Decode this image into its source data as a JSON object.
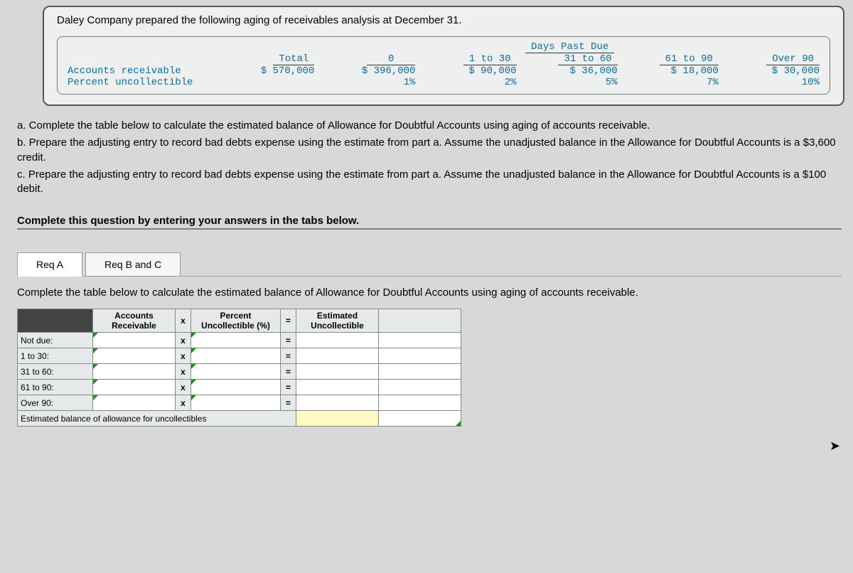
{
  "intro": "Daley Company prepared the following aging of receivables analysis at December 31.",
  "aging": {
    "days_past_due_header": "Days Past Due",
    "cols": [
      "Total",
      "0",
      "1 to 30",
      "31 to 60",
      "61 to 90",
      "Over 90"
    ],
    "rows": {
      "ar_label": "Accounts receivable",
      "ar_vals": [
        "$ 570,000",
        "$ 396,000",
        "$ 90,000",
        "$ 36,000",
        "$ 18,000",
        "$ 30,000"
      ],
      "pu_label": "Percent uncollectible",
      "pu_vals": [
        "",
        "1%",
        "2%",
        "5%",
        "7%",
        "10%"
      ]
    }
  },
  "instructions": {
    "a": "a. Complete the table below to calculate the estimated balance of Allowance for Doubtful Accounts using aging of accounts receivable.",
    "b": "b. Prepare the adjusting entry to record bad debts expense using the estimate from part a. Assume the unadjusted balance in the Allowance for Doubtful Accounts is a $3,600 credit.",
    "c": "c. Prepare the adjusting entry to record bad debts expense using the estimate from part a. Assume the unadjusted balance in the Allowance for Doubtful Accounts is a $100 debit."
  },
  "tabs_prompt": "Complete this question by entering your answers in the tabs below.",
  "tabs": {
    "a": "Req A",
    "bc": "Req B and C"
  },
  "req_a_text": "Complete the table below to calculate the estimated balance of Allowance for Doubtful Accounts using aging of accounts receivable.",
  "worksheet": {
    "headers": {
      "ar": "Accounts Receivable",
      "times": "x",
      "percent": "Percent Uncollectible (%)",
      "equals": "=",
      "est": "Estimated Uncollectible"
    },
    "rows": [
      {
        "label": "Not due:"
      },
      {
        "label": "1 to 30:"
      },
      {
        "label": "31 to 60:"
      },
      {
        "label": "61 to 90:"
      },
      {
        "label": "Over 90:"
      }
    ],
    "total_row": "Estimated balance of allowance for uncollectibles"
  },
  "chart_data": {
    "type": "table",
    "title": "Aging of Receivables Analysis at December 31",
    "categories": [
      "Total",
      "0",
      "1 to 30",
      "31 to 60",
      "61 to 90",
      "Over 90"
    ],
    "series": [
      {
        "name": "Accounts receivable ($)",
        "values": [
          570000,
          396000,
          90000,
          36000,
          18000,
          30000
        ]
      },
      {
        "name": "Percent uncollectible (%)",
        "values": [
          null,
          1,
          2,
          5,
          7,
          10
        ]
      }
    ]
  }
}
